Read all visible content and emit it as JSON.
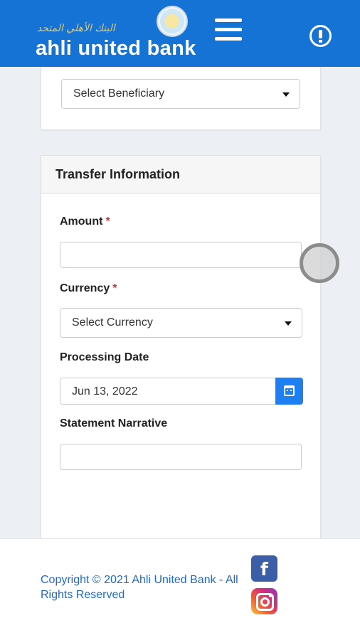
{
  "header": {
    "logo_arabic": "البنك الأهلي المتحد",
    "logo_text": "ahli united bank",
    "brand_color": "#1573d6",
    "menu_icon": "hamburger-menu-icon",
    "info_icon": "info-icon"
  },
  "beneficiary": {
    "select_value": "Select Beneficiary"
  },
  "transfer": {
    "title": "Transfer Information",
    "amount_label": "Amount",
    "amount_value": "",
    "currency_label": "Currency",
    "currency_value": "Select Currency",
    "processing_date_label": "Processing Date",
    "processing_date_value": "Jun 13, 2022",
    "narrative_label": "Statement Narrative",
    "narrative_value": "",
    "required_marker": "*"
  },
  "footer": {
    "copyright": "Copyright © 2021 Ahli United Bank - All Rights Reserved",
    "facebook_icon": "facebook-icon",
    "instagram_icon": "instagram-icon",
    "link_color": "#1f6ac4"
  }
}
